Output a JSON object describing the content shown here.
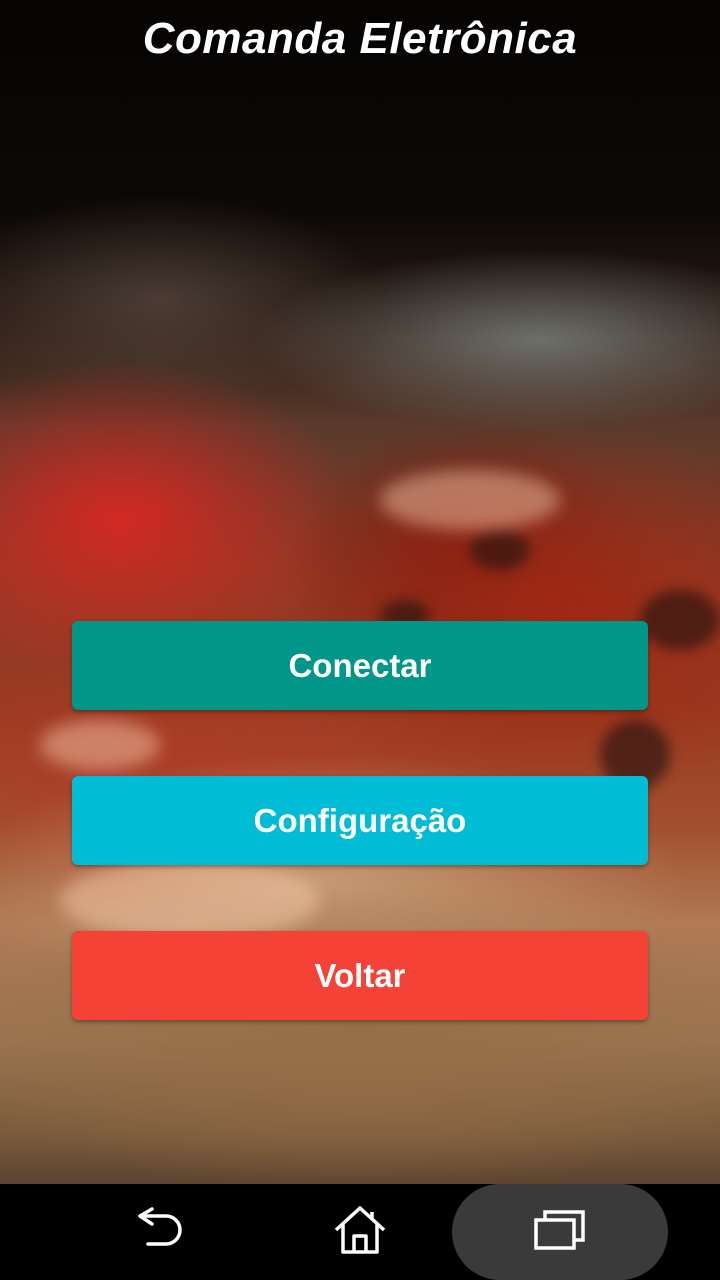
{
  "app": {
    "title": "Comanda Eletrônica"
  },
  "buttons": {
    "connect_label": "Conectar",
    "config_label": "Configuração",
    "back_label": "Voltar"
  },
  "colors": {
    "connect": "#009688",
    "config": "#00BCD4",
    "back": "#F44336",
    "navbar": "#000000"
  },
  "navbar": {
    "back_icon": "back-arrow-icon",
    "home_icon": "home-icon",
    "recents_icon": "recent-apps-icon"
  }
}
